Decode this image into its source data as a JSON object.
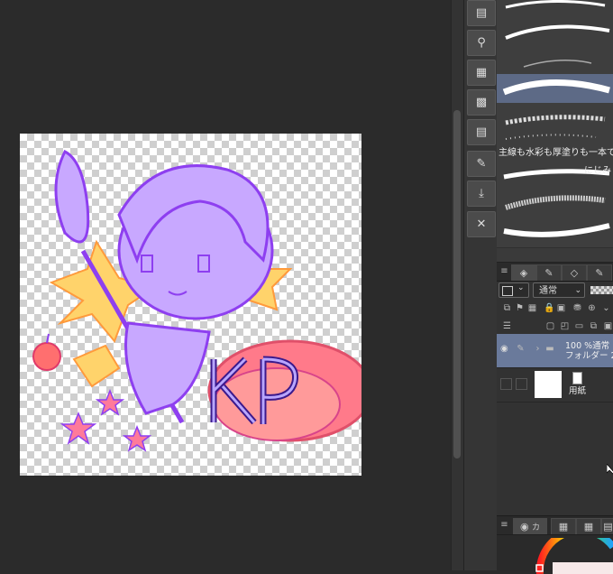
{
  "brushes": {
    "description": "主線も水彩も厚塗りも一本で",
    "named_brush": "にじみ",
    "selected_index": 2
  },
  "layers": {
    "blend_mode": "通常",
    "folder": {
      "line1": "100 %通常",
      "line2": "フォルダー 2"
    },
    "paper": {
      "label": "用紙"
    }
  },
  "color_panel": {
    "tab_label": "カ"
  },
  "colors": {
    "accent_selected": "#5d6a86",
    "layer_selected": "#6a7a9b",
    "sketch": "#9b59f0"
  }
}
